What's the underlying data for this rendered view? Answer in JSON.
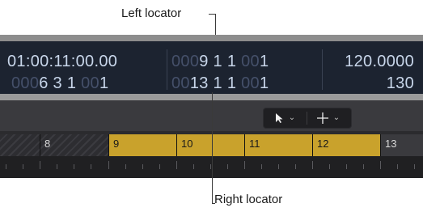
{
  "callouts": {
    "left_locator": "Left locator",
    "right_locator": "Right locator"
  },
  "lcd": {
    "timecode": "01:00:11:00.00",
    "bars_position": {
      "dim": "000",
      "value": "6 3 1",
      "dim2": " 00",
      "tail": "1"
    },
    "left_locator": {
      "dim": "000",
      "value": "9 1 1",
      "dim2": " 00",
      "tail": "1"
    },
    "right_locator": {
      "dim": "00",
      "value": "13 1 1",
      "dim2": " 00",
      "tail": "1"
    },
    "tempo": "120.0000",
    "signature": "130"
  },
  "toolbar": {
    "pointer_tool": "pointer-icon",
    "marquee_tool": "crosshair-icon"
  },
  "ruler": {
    "bars": [
      "8",
      "9",
      "10",
      "11",
      "12",
      "13"
    ],
    "cycle_color": "#c9a22c"
  }
}
